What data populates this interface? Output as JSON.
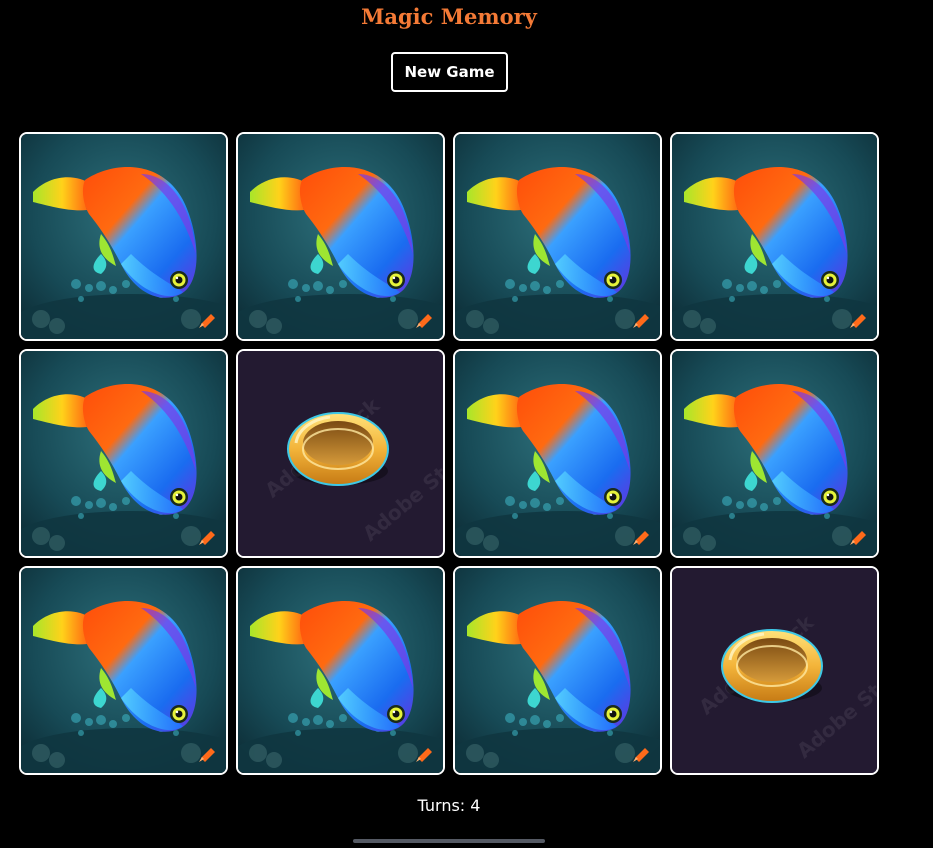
{
  "app": {
    "title": "Magic Memory",
    "new_game_label": "New Game",
    "turns_label": "Turns:",
    "turns_value": 4,
    "turns_text": "Turns: 4"
  },
  "colors": {
    "background": "#000000",
    "title": "#f47a36",
    "card_border": "#ffffff",
    "revealed_bg": "#231a31"
  },
  "board": {
    "columns": 4,
    "rows": 3,
    "cards": [
      {
        "state": "face-down",
        "image": "fish-card-back"
      },
      {
        "state": "face-down",
        "image": "fish-card-back"
      },
      {
        "state": "face-down",
        "image": "fish-card-back"
      },
      {
        "state": "face-down",
        "image": "fish-card-back"
      },
      {
        "state": "face-down",
        "image": "fish-card-back"
      },
      {
        "state": "face-up",
        "image": "gold-ring",
        "watermark": "Adobe Stock"
      },
      {
        "state": "face-down",
        "image": "fish-card-back"
      },
      {
        "state": "face-down",
        "image": "fish-card-back"
      },
      {
        "state": "face-down",
        "image": "fish-card-back"
      },
      {
        "state": "face-down",
        "image": "fish-card-back"
      },
      {
        "state": "face-down",
        "image": "fish-card-back"
      },
      {
        "state": "face-up",
        "image": "gold-ring",
        "watermark": "Adobe Stock"
      }
    ]
  }
}
